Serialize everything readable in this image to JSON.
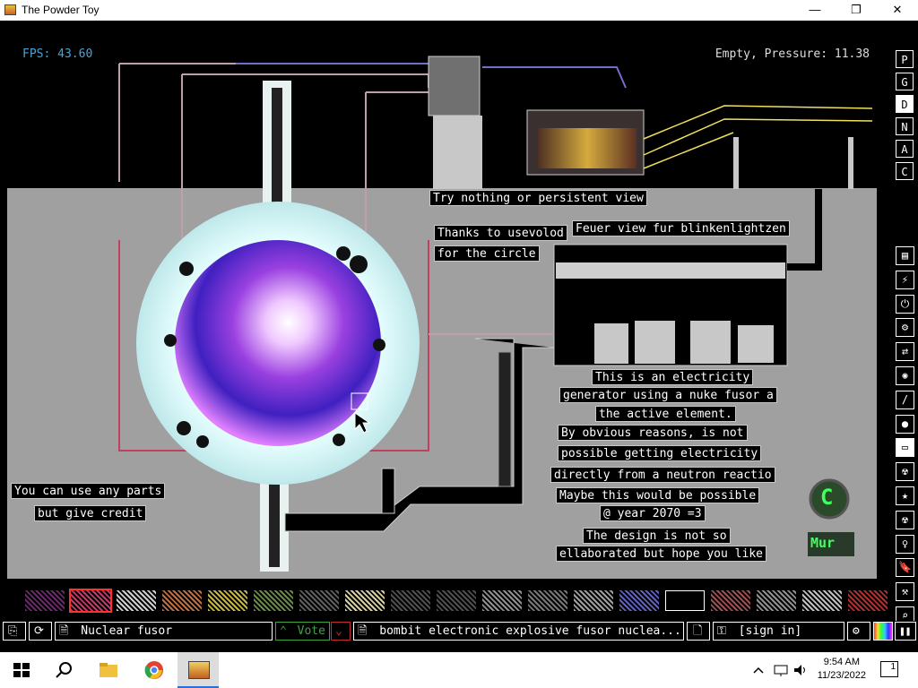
{
  "window": {
    "title": "The Powder Toy",
    "minimize": "—",
    "maximize": "❐",
    "close": "✕"
  },
  "hud": {
    "fps": "FPS: 43.60",
    "pressure": "Empty, Pressure: 11.38"
  },
  "signs": {
    "try_view": "Try nothing or persistent view",
    "thanks_1": "Thanks to usevolod",
    "thanks_2": "for the circle",
    "feuer": "Feuer view fur blinkenlightzen",
    "desc_1": "This is an electricity",
    "desc_2": "generator using a nuke fusor a",
    "desc_3": "the active element.",
    "desc_4": "By obvious reasons, is not",
    "desc_5": "possible getting electricity",
    "desc_6": "directly from a neutron reactio",
    "desc_7": "Maybe this would be possible",
    "desc_8": "@ year 2070 =3",
    "design_1": "The design is not so",
    "design_2": "ellaborated but hope you like",
    "credit_1": "You can use any parts",
    "credit_2": "but give credit",
    "badge_c": "C",
    "badge_mur": "Mur"
  },
  "render_modes": [
    "P",
    "G",
    "D",
    "N",
    "A",
    "C"
  ],
  "categories": [
    "▤",
    "⚡",
    "⏻",
    "⚙",
    "⇄",
    "✺",
    "/",
    "●",
    "▭",
    "☢",
    "★",
    "☢",
    "♀",
    "🔖",
    "⚒",
    "⌕"
  ],
  "palette_colors": [
    "#6a2a6a",
    "#c03a6a",
    "#d0d0d0",
    "#c07040",
    "#c8b840",
    "#6a8a4a",
    "#606060",
    "#d8d0a0",
    "#505050",
    "#505050",
    "#909090",
    "#787878",
    "#a0a0a0",
    "#6060c0",
    "#ffffff",
    "#a05050",
    "#909090",
    "#c0c0c0",
    "#b03030"
  ],
  "bottom": {
    "open_icon": "⎘",
    "reload_icon": "⟳",
    "save_icon": "🗎",
    "save_name": "Nuclear fusor",
    "vote_label": "Vote",
    "vote_up": "⌃",
    "vote_down": "⌄",
    "tags_icon": "🗎",
    "tags": "bombit electronic explosive fusor nuclea...",
    "new_icon": "🗋",
    "login_icon": "⚿",
    "login": "[sign in]",
    "settings_icon": "⚙",
    "pause": "❚❚"
  },
  "taskbar": {
    "time": "9:54 AM",
    "date": "11/23/2022",
    "notifications": "1"
  },
  "colors": {
    "fps": "#4aa3d6",
    "vote_green": "#3fa53f",
    "vote_red": "#c03030",
    "sim_gray": "#a0a0a0"
  }
}
